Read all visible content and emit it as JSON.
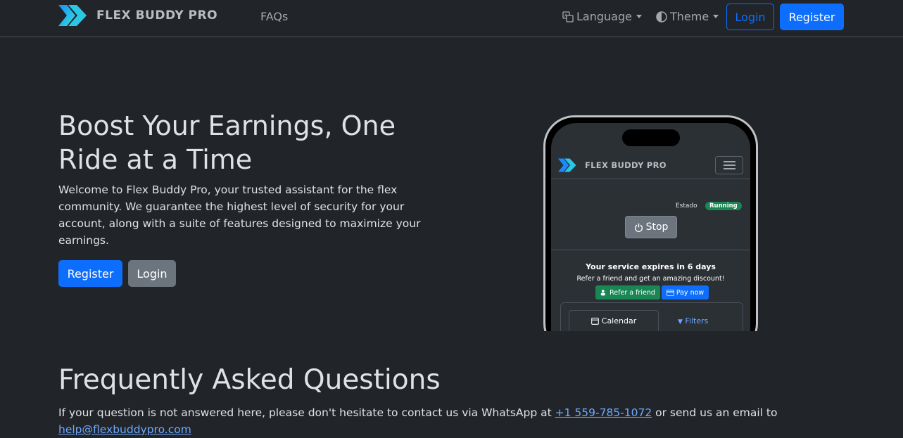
{
  "nav": {
    "brand": "FLEX BUDDY PRO",
    "faqs": "FAQs",
    "language": "Language",
    "theme": "Theme",
    "login": "Login",
    "register": "Register"
  },
  "hero": {
    "title": "Boost Your Earnings, One Ride at a Time",
    "text": "Welcome to Flex Buddy Pro, your trusted assistant for the flex community. We guarantee the highest level of security for your account, along with a suite of features designed to maximize your earnings.",
    "register": "Register",
    "login": "Login"
  },
  "phone": {
    "brand": "FLEX BUDDY PRO",
    "status_label": "Estado",
    "status_badge": "Running",
    "stop": "Stop",
    "expires": "Your service expires in 6 days",
    "refer_text": "Refer a friend and get an amazing discount!",
    "refer_btn": "Refer a friend",
    "pay_btn": "Pay now",
    "tab_calendar": "Calendar",
    "tab_filters": "Filters"
  },
  "faq": {
    "title": "Frequently Asked Questions",
    "text_before": "If your question is not answered here, please don't hesitate to contact us via WhatsApp at ",
    "phone": "+1 559-785-1072",
    "text_middle": " or send us an email to ",
    "email": "help@flexbuddypro.com"
  },
  "colors": {
    "background": "#212529",
    "primary": "#0d6efd",
    "secondary": "#6c757d",
    "success": "#198754",
    "link": "#6ea8fe"
  },
  "icons": [
    "logo-icon",
    "translate-icon",
    "half-circle-theme-icon",
    "power-icon",
    "people-icon",
    "credit-card-icon",
    "calendar-icon",
    "filter-icon",
    "menu-icon"
  ]
}
